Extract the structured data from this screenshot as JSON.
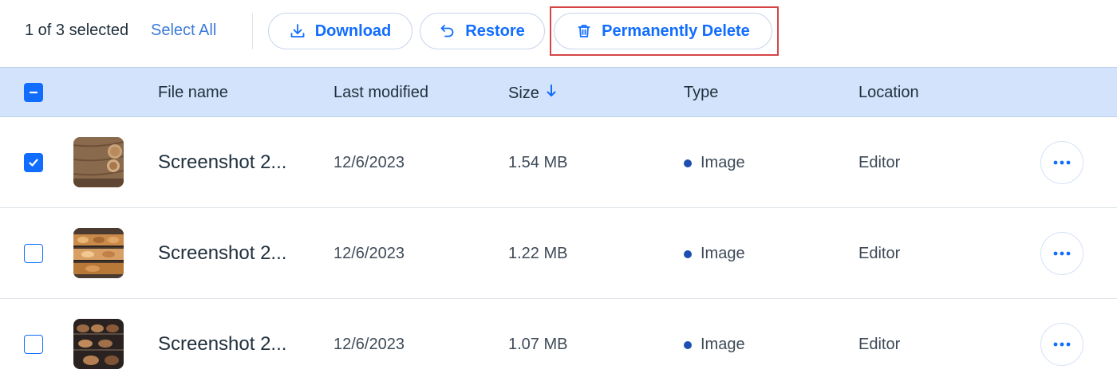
{
  "toolbar": {
    "selection_count": "1 of 3 selected",
    "select_all_label": "Select All",
    "download_label": "Download",
    "restore_label": "Restore",
    "permanently_delete_label": "Permanently Delete",
    "highlight_color": "#d64545"
  },
  "table": {
    "columns": {
      "file_name": "File name",
      "last_modified": "Last modified",
      "size": "Size",
      "type": "Type",
      "location": "Location"
    },
    "sort": {
      "column": "size",
      "direction": "descending",
      "icon": "arrow-down-icon"
    },
    "header_checkbox_state": "indeterminate",
    "rows": [
      {
        "selected": true,
        "name": "Screenshot 2...",
        "last_modified": "12/6/2023",
        "size": "1.54 MB",
        "type": "Image",
        "location": "Editor",
        "thumbnail": "wooden-table-bread-photo"
      },
      {
        "selected": false,
        "name": "Screenshot 2...",
        "last_modified": "12/6/2023",
        "size": "1.22 MB",
        "type": "Image",
        "location": "Editor",
        "thumbnail": "bakery-display-case-photo"
      },
      {
        "selected": false,
        "name": "Screenshot 2...",
        "last_modified": "12/6/2023",
        "size": "1.07 MB",
        "type": "Image",
        "location": "Editor",
        "thumbnail": "bread-shelves-photo"
      }
    ]
  },
  "colors": {
    "accent": "#116dff",
    "header_bg": "#d4e3fc",
    "type_dot": "#1d4fb0"
  }
}
